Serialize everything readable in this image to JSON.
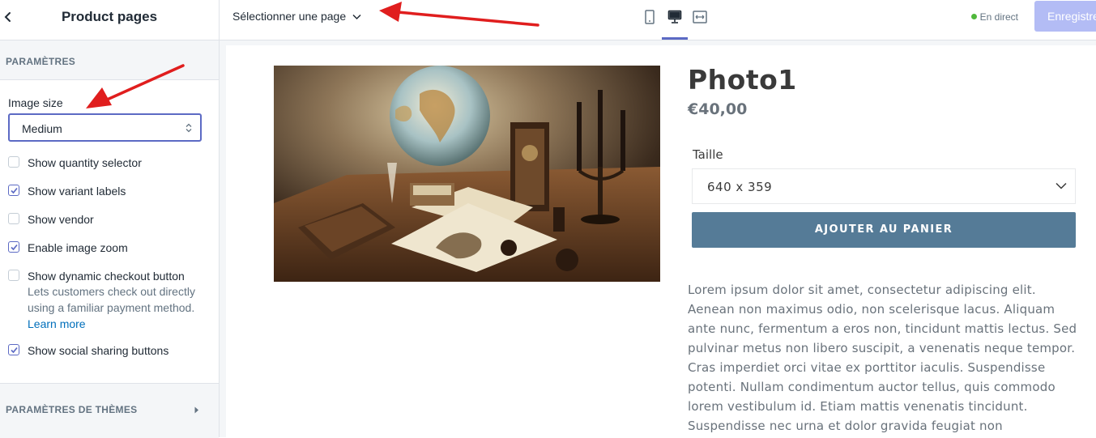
{
  "sidebar": {
    "title": "Product pages",
    "section_label": "PARAMÈTRES",
    "image_size": {
      "label": "Image size",
      "value": "Medium"
    },
    "options": [
      {
        "label": "Show quantity selector",
        "checked": false
      },
      {
        "label": "Show variant labels",
        "checked": true
      },
      {
        "label": "Show vendor",
        "checked": false
      },
      {
        "label": "Enable image zoom",
        "checked": true
      },
      {
        "label": "Show dynamic checkout button",
        "checked": false
      },
      {
        "label": "Show social sharing buttons",
        "checked": true
      }
    ],
    "dynamic_help": "Lets customers check out directly using a familiar payment method.",
    "learn_more": "Learn more",
    "theme_settings_label": "PARAMÈTRES DE THÈMES"
  },
  "topbar": {
    "page_select": "Sélectionner une page",
    "live_status": "En direct",
    "save_label": "Enregistrer",
    "views": [
      "mobile-icon",
      "desktop-icon",
      "full-width-icon"
    ],
    "active_view": "desktop-icon"
  },
  "product": {
    "title": "Photo1",
    "price": "€40,00",
    "variant_label": "Taille",
    "variant_value": "640 x 359",
    "add_to_cart": "AJOUTER AU PANIER",
    "description": "Lorem ipsum dolor sit amet, consectetur adipiscing elit. Aenean non maximus odio, non scelerisque lacus. Aliquam ante nunc, fermentum a eros non, tincidunt mattis lectus. Sed pulvinar metus non libero suscipit, a venenatis neque tempor. Cras imperdiet orci vitae ex porttitor iaculis. Suspendisse potenti. Nullam condimentum auctor tellus, quis commodo lorem vestibulum id. Etiam mattis venenatis tincidunt. Suspendisse nec urna et dolor gravida feugiat non"
  },
  "colors": {
    "accent": "#5c6ac4",
    "button": "#557b97",
    "annotation_arrow": "#e01e1e",
    "live_dot": "#50b83c"
  }
}
